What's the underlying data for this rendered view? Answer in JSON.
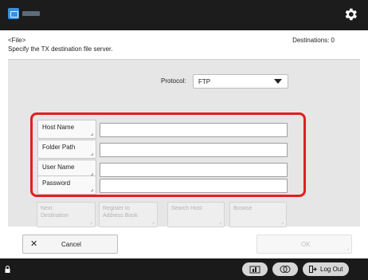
{
  "header": {
    "icon": "device-app-icon",
    "gear_icon": "gear-icon"
  },
  "info": {
    "mode": "<File>",
    "instruction": "Specify the TX destination file server.",
    "destinations": "Destinations:  0"
  },
  "protocol": {
    "label": "Protocol:",
    "value": "FTP"
  },
  "fields": {
    "host_name": {
      "label": "Host Name",
      "value": ""
    },
    "folder_path": {
      "label": "Folder Path",
      "value": ""
    },
    "user_name": {
      "label": "User Name",
      "value": ""
    },
    "password": {
      "label": "Password",
      "value": ""
    }
  },
  "actions": {
    "next_destination": "Next\nDestination",
    "register_to_address_book": "Register to\nAddress Book",
    "search_host": "Search Host",
    "browse": "Browse"
  },
  "footer": {
    "cancel": "Cancel",
    "ok": "OK"
  },
  "statusbar": {
    "logout": "Log Out"
  },
  "colors": {
    "topbar": "#1c1c1c",
    "highlight": "#e0201e",
    "panel": "#e6e6e6",
    "app_icon": "#3d8fd8"
  }
}
